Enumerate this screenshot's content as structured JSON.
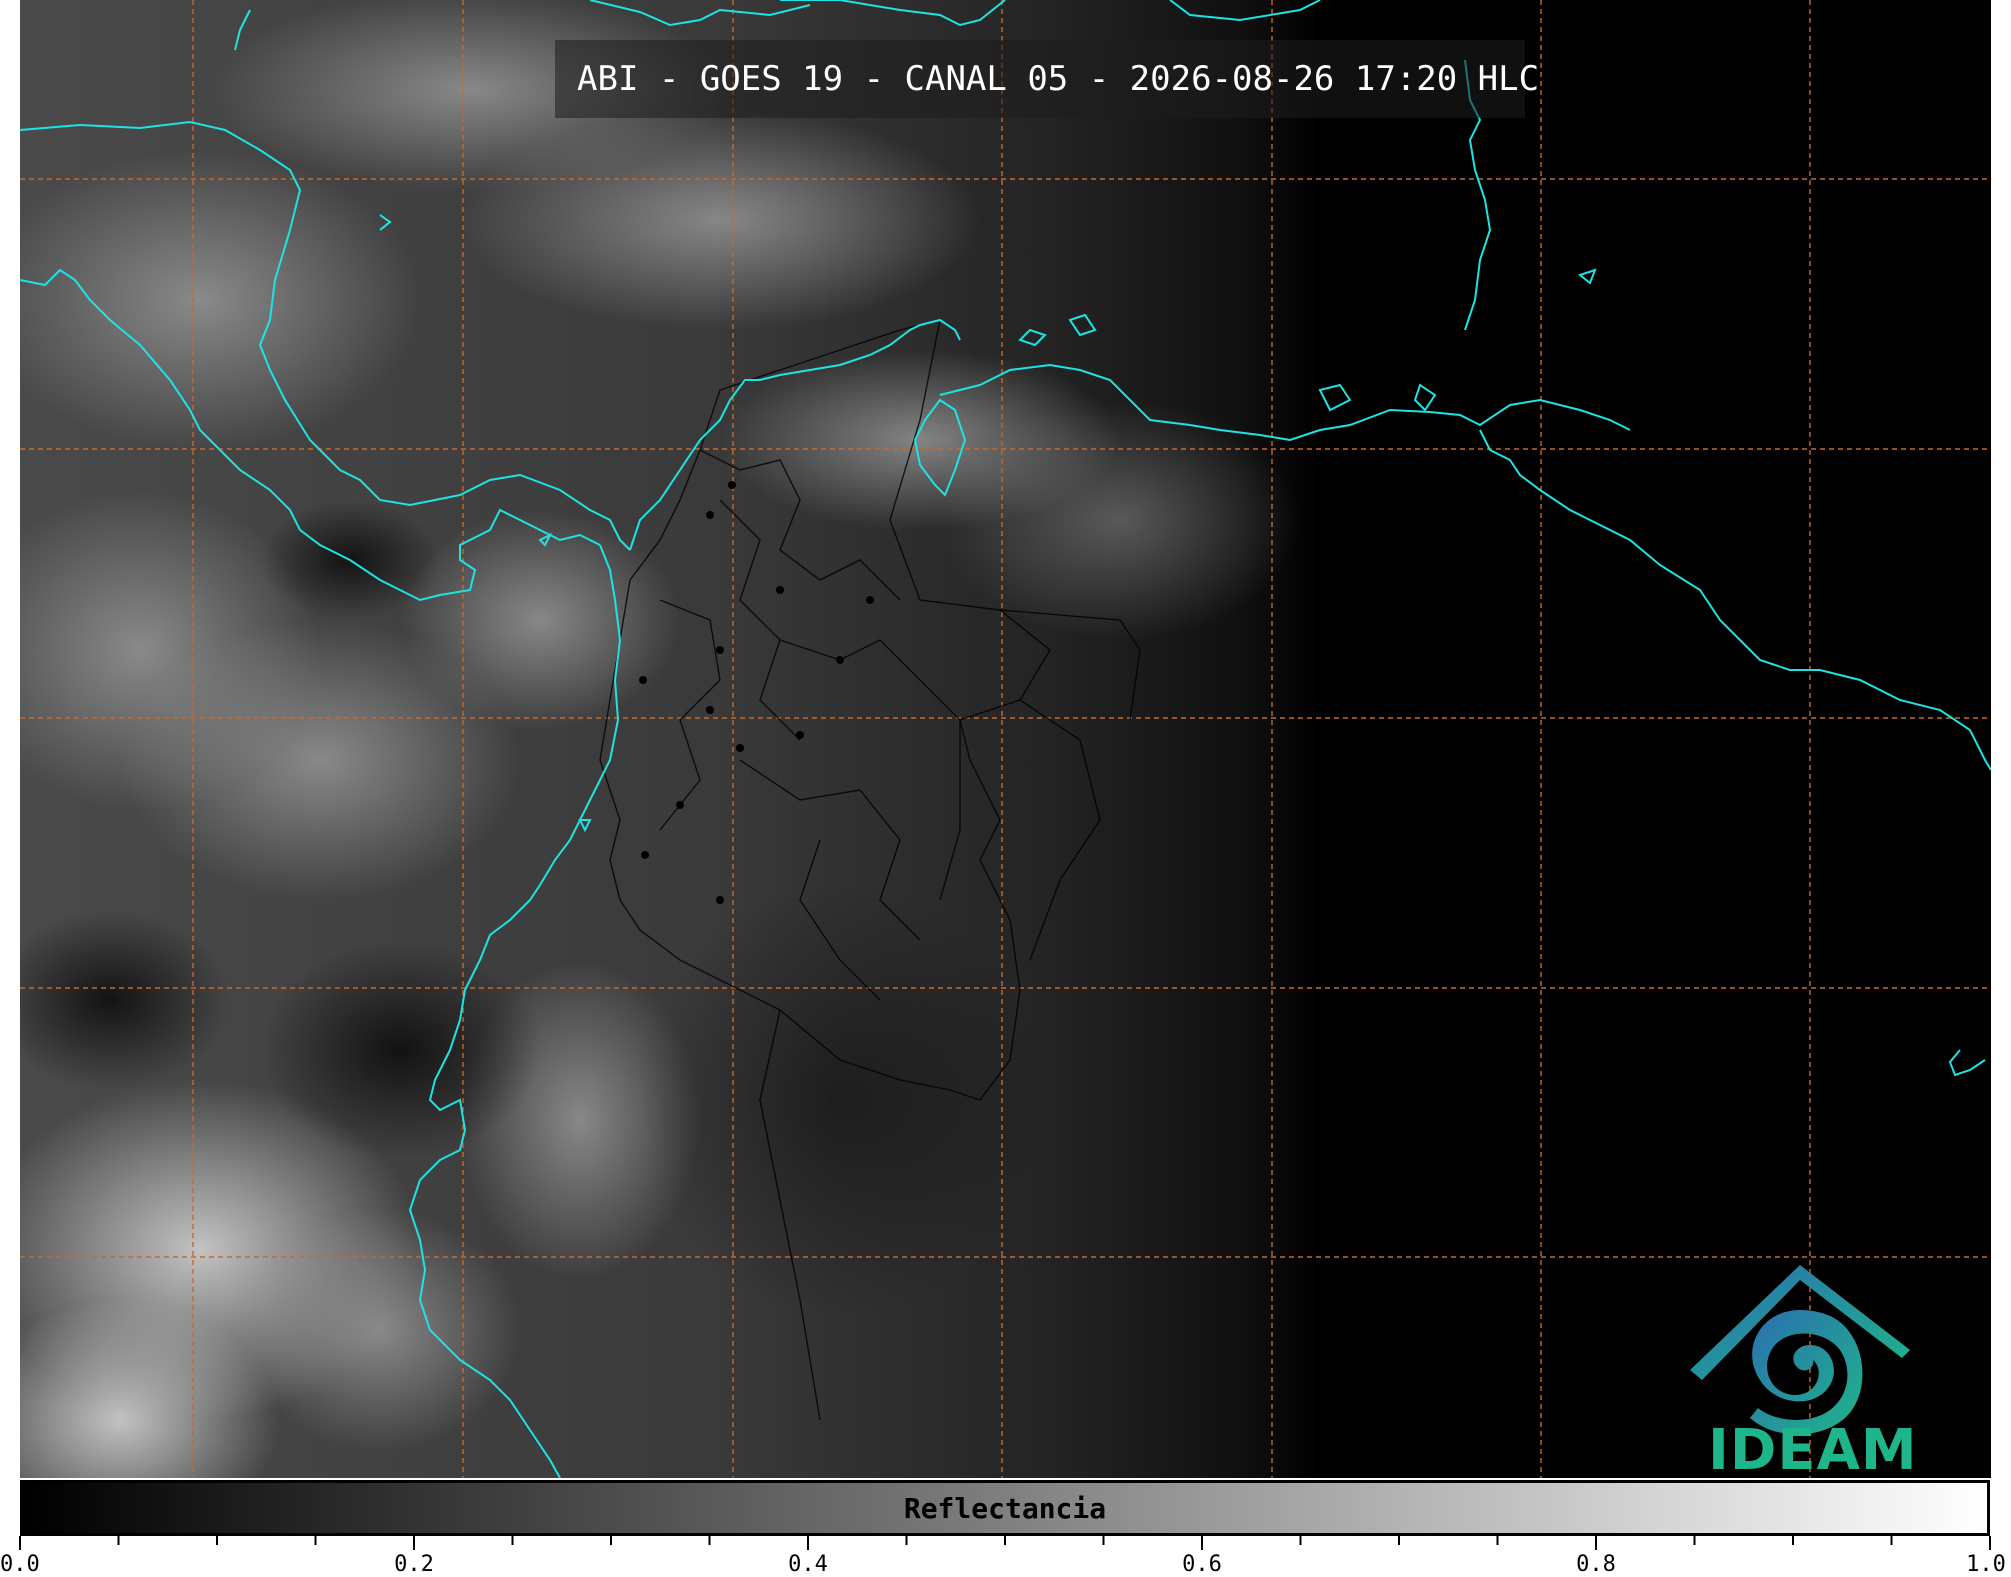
{
  "title": "ABI - GOES 19 - CANAL 05 - 2026-08-26 17:20 HLC",
  "logo_text": "IDEAM",
  "colorbar": {
    "label": "Reflectancia",
    "min": 0.0,
    "max": 1.0,
    "ticks": [
      "0.0",
      "0.2",
      "0.4",
      "0.6",
      "0.8",
      "1.0"
    ],
    "color_low": "#000000",
    "color_high": "#ffffff"
  },
  "colors": {
    "coastline": "#1ee3e3",
    "grid": "#c86a28",
    "borders": "#000000",
    "logo_blue": "#2a6fb0",
    "logo_teal": "#1fb58a"
  }
}
